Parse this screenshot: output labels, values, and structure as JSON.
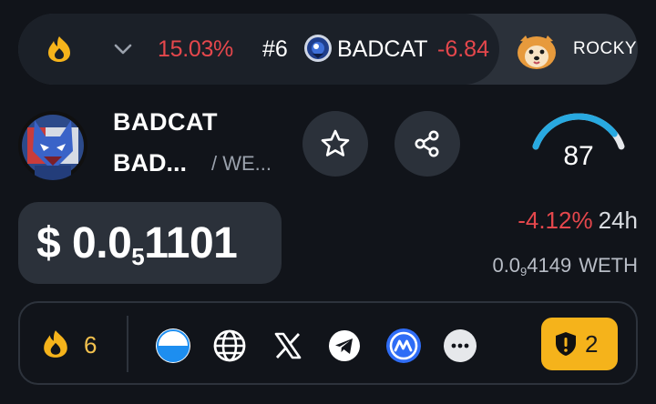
{
  "ticker": {
    "percent": "15.03%",
    "rank": "#6",
    "token": "BADCAT",
    "change": "-6.84",
    "featured": "ROCKY"
  },
  "token": {
    "name": "BADCAT",
    "subname": "BAD...",
    "pair": "/ WE...",
    "score": "87",
    "score_fraction": 0.87
  },
  "price": {
    "prefix": "$ 0.0",
    "zeros": "5",
    "digits": "1101",
    "change_24h": "-4.12%",
    "period": "24h",
    "weth_prefix": "0.0",
    "weth_zeros": "9",
    "weth_digits": "4149",
    "weth_unit": "WETH"
  },
  "social": {
    "flame_count": "6",
    "icons": [
      "website-orb-icon",
      "globe-icon",
      "x-icon",
      "telegram-icon",
      "coinmarketcap-icon",
      "more-icon"
    ],
    "alerts": "2"
  },
  "colors": {
    "negative": "#e5474c",
    "gauge": "#28a9e0",
    "accent_yellow": "#f5b31b"
  }
}
